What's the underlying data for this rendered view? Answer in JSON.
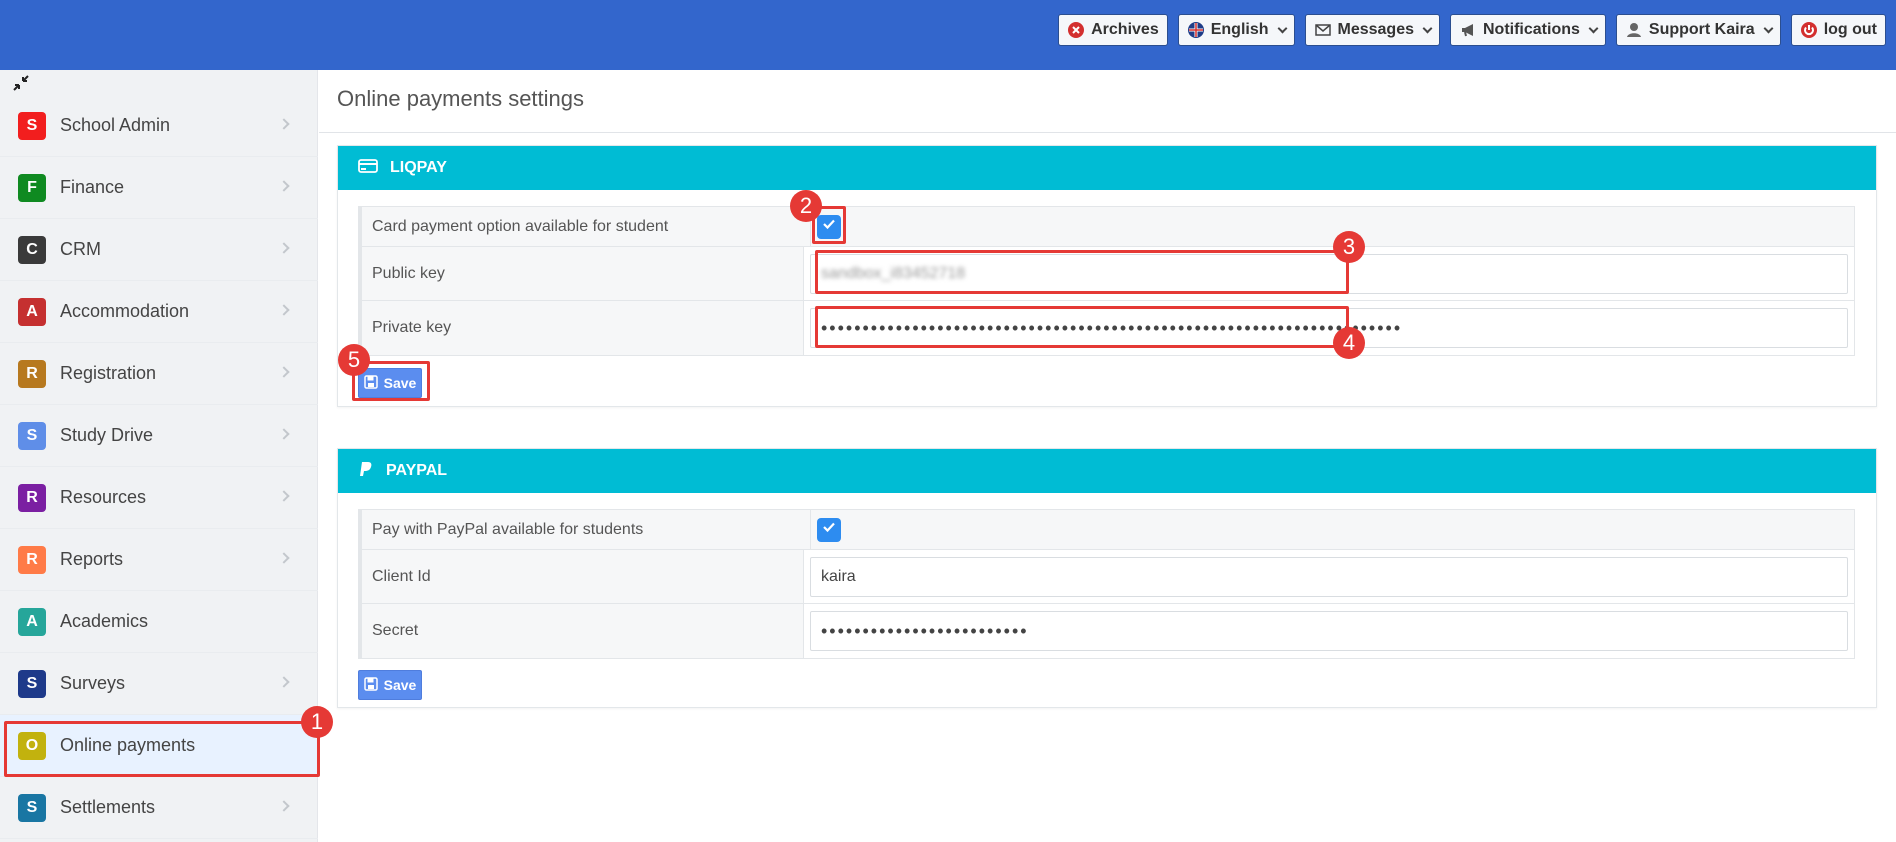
{
  "colors": {
    "topbar": "#3366cc",
    "section_header": "#00bcd4",
    "annotation": "#e53935"
  },
  "topbar": {
    "buttons": [
      {
        "label": "Archives",
        "icon": "x-circle-icon"
      },
      {
        "label": "English",
        "icon": "uk-flag-icon"
      },
      {
        "label": "Messages",
        "icon": "envelope-icon"
      },
      {
        "label": "Notifications",
        "icon": "megaphone-icon"
      },
      {
        "label": "Support Kaira",
        "icon": "user-icon"
      },
      {
        "label": "log out",
        "icon": "power-icon"
      }
    ]
  },
  "sidebar": {
    "items": [
      {
        "letter": "S",
        "label": "School Admin",
        "color": "#f21e1e"
      },
      {
        "letter": "F",
        "label": "Finance",
        "color": "#0f8a21"
      },
      {
        "letter": "C",
        "label": "CRM",
        "color": "#3a3a3a"
      },
      {
        "letter": "A",
        "label": "Accommodation",
        "color": "#c53030"
      },
      {
        "letter": "R",
        "label": "Registration",
        "color": "#b7791f"
      },
      {
        "letter": "S",
        "label": "Study Drive",
        "color": "#5f8ee8"
      },
      {
        "letter": "R",
        "label": "Resources",
        "color": "#7b1fa2"
      },
      {
        "letter": "R",
        "label": "Reports",
        "color": "#ff7b47"
      },
      {
        "letter": "A",
        "label": "Academics",
        "color": "#26a69a"
      },
      {
        "letter": "S",
        "label": "Surveys",
        "color": "#1e3a8a"
      },
      {
        "letter": "O",
        "label": "Online payments",
        "color": "#c2b20e"
      },
      {
        "letter": "S",
        "label": "Settlements",
        "color": "#1976a3"
      }
    ]
  },
  "page": {
    "title": "Online payments settings"
  },
  "liqpay": {
    "title": "LIQPAY",
    "card_option_label": "Card payment option available for student",
    "public_key_label": "Public key",
    "public_key_value": "sandbox_i83452718",
    "private_key_label": "Private key",
    "private_key_value": "••••••••••••••••••••••••••••••••••••••••••••••••••••••••••••••••••••••",
    "save_label": "Save"
  },
  "paypal": {
    "title": "PAYPAL",
    "option_label": "Pay with PayPal available for students",
    "client_id_label": "Client Id",
    "client_id_value": "kaira",
    "secret_label": "Secret",
    "secret_value": "•••••••••••••••••••••••••",
    "save_label": "Save"
  },
  "annotations": {
    "markers": [
      "1",
      "2",
      "3",
      "4",
      "5"
    ]
  }
}
